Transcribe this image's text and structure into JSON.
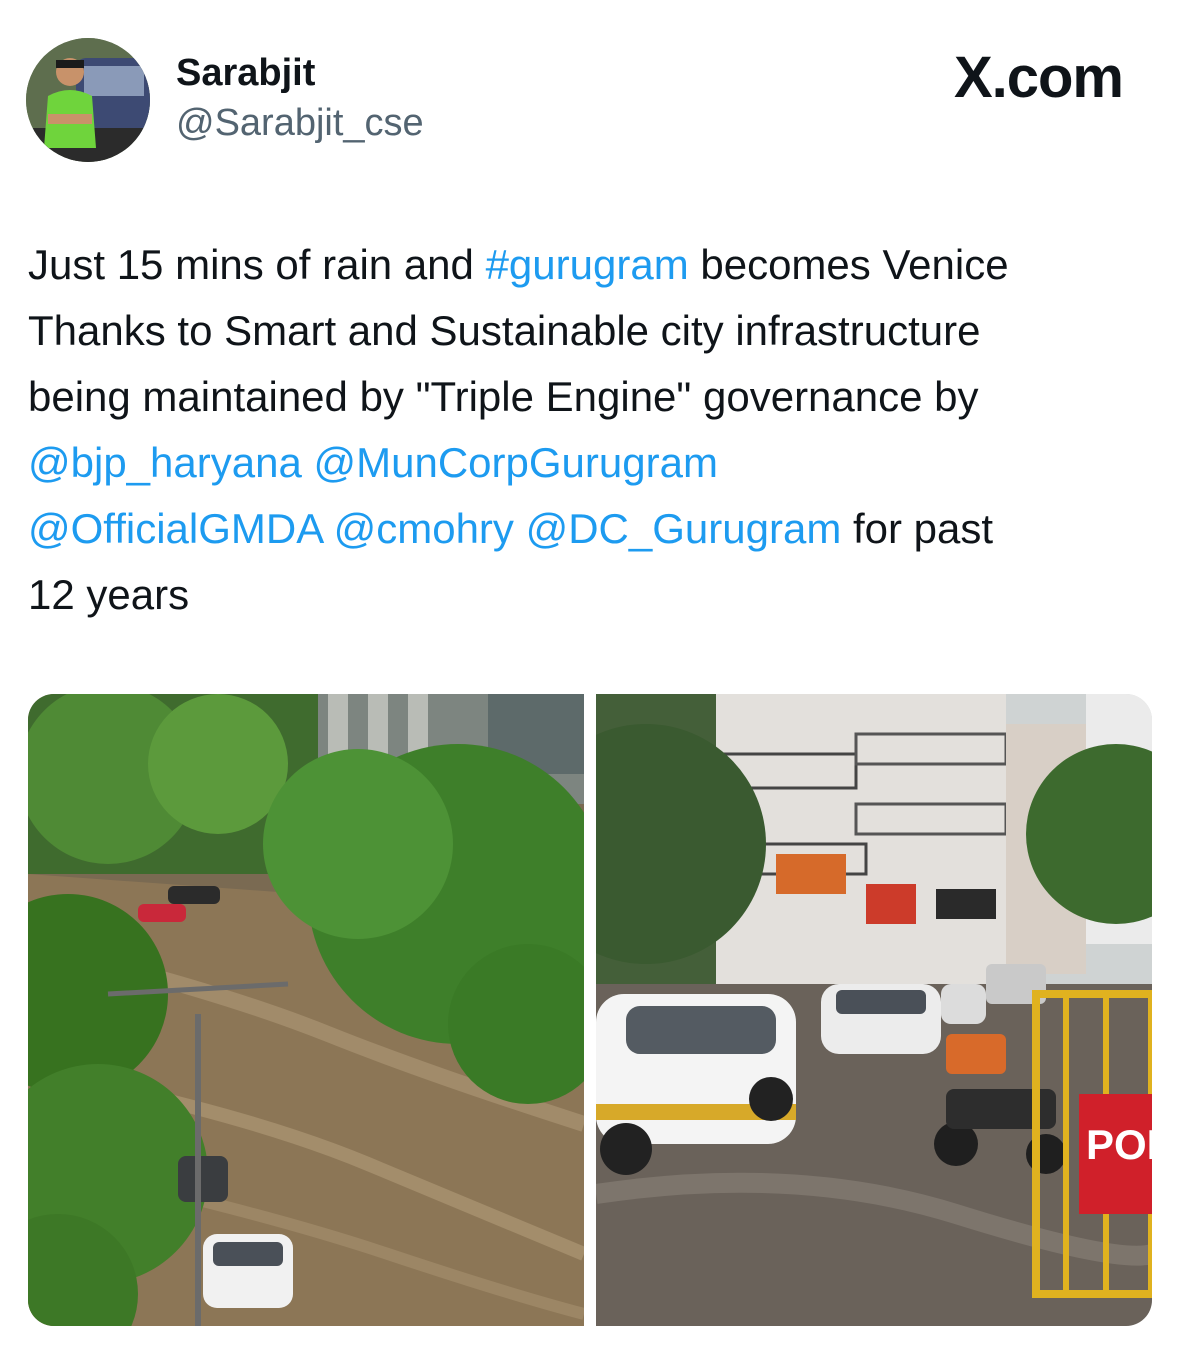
{
  "header": {
    "display_name": "Sarabjit",
    "handle": "@Sarabjit_cse",
    "brand": "X.com"
  },
  "tweet": {
    "line1": {
      "a": "Just 15 mins of rain and ",
      "hashtag": "#gurugram",
      "b": " becomes Venice"
    },
    "line2": "Thanks to Smart and Sustainable city infrastructure",
    "line3": "being maintained by \"Triple Engine\" governance by",
    "line4": {
      "m1": "@bjp_haryana",
      "sp": " ",
      "m2": "@MunCorpGurugram"
    },
    "line5": {
      "m3": "@OfficialGMDA",
      "m4": "@cmohry",
      "m5": "@DC_Gurugram",
      "tail": " for past"
    },
    "line6": "12 years"
  },
  "media": {
    "photo_right_sign": "POL"
  },
  "colors": {
    "link": "#1d9bf0",
    "text": "#0f1419",
    "secondary": "#536471"
  }
}
